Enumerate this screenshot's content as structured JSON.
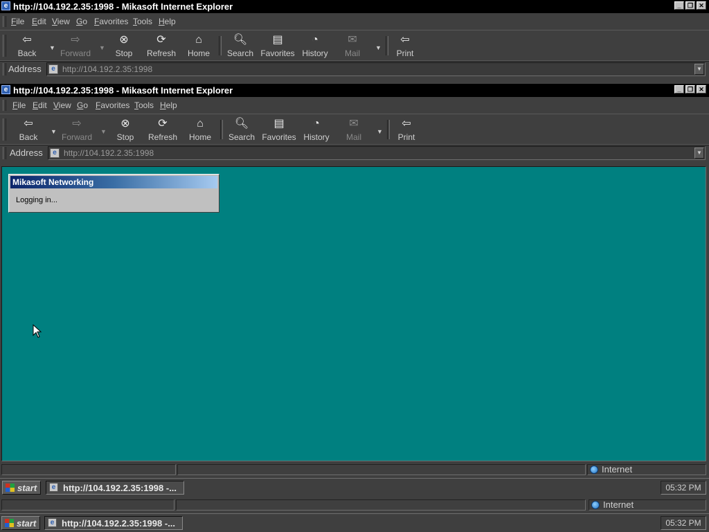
{
  "window": {
    "title": "http://104.192.2.35:1998 - Mikasoft Internet Explorer",
    "icon": "ie-page-icon",
    "controls": [
      "minimize-icon",
      "restore-icon",
      "close-icon"
    ]
  },
  "menu": [
    {
      "name": "File",
      "key": "F",
      "rest": "ile"
    },
    {
      "name": "Edit",
      "key": "E",
      "rest": "dit"
    },
    {
      "name": "View",
      "key": "V",
      "rest": "iew"
    },
    {
      "name": "Go",
      "key": "G",
      "rest": "o"
    },
    {
      "name": "Favorites",
      "key": "F",
      "rest": "avorites"
    },
    {
      "name": "Tools",
      "key": "T",
      "rest": "ools"
    },
    {
      "name": "Help",
      "key": "H",
      "rest": "elp"
    }
  ],
  "toolbar": {
    "back": "Back",
    "forward": "Forward",
    "stop": "Stop",
    "refresh": "Refresh",
    "home": "Home",
    "search": "Search",
    "favorites": "Favorites",
    "history": "History",
    "mail": "Mail",
    "print": "Print"
  },
  "address": {
    "label": "Address",
    "url_top": "http://104.192.2.35:1998",
    "url_bottom": "http://104.192.2.35:1998"
  },
  "dialog": {
    "title": "Mikasoft Networking",
    "message": "Logging in..."
  },
  "status": {
    "zone": "Internet"
  },
  "taskbar": {
    "start": "start",
    "task_label": "http://104.192.2.35:1998 -...",
    "clock": "05:32 PM"
  },
  "colors": {
    "desktop": "#008080",
    "titlebar": "#000000",
    "dialog_title_start": "#0a246a",
    "dialog_title_end": "#a6caf0"
  }
}
